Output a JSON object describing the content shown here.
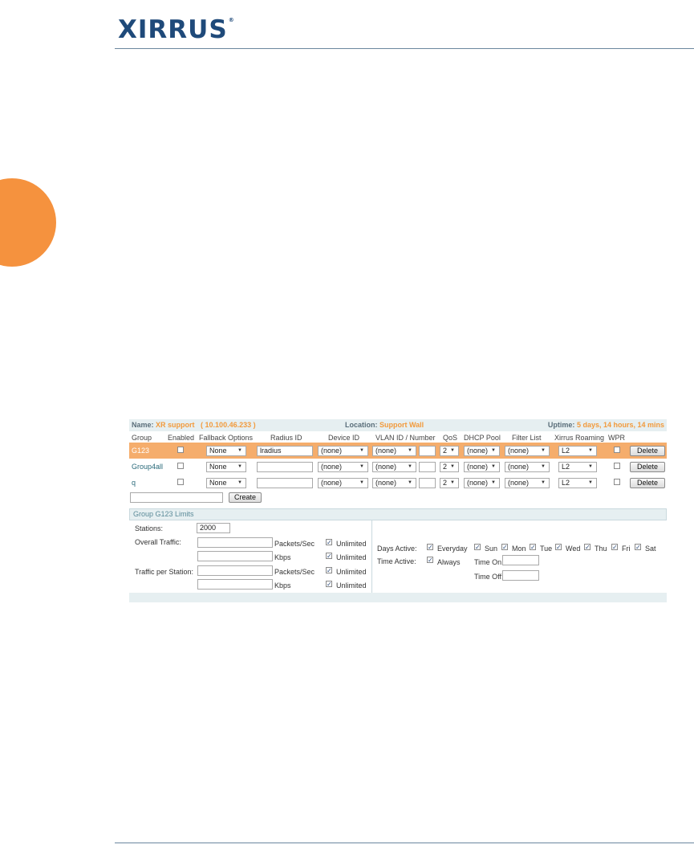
{
  "brand": {
    "logo_text": "XIRRUS",
    "logo_mark": "®"
  },
  "header": {
    "name_label": "Name:",
    "name_value": "XR support",
    "ip_value": "( 10.100.46.233 )",
    "location_label": "Location:",
    "location_value": "Support Wall",
    "uptime_label": "Uptime:",
    "uptime_value": "5 days, 14 hours, 14 mins"
  },
  "columns": [
    "Group",
    "Enabled",
    "Fallback Options",
    "Radius ID",
    "Device ID",
    "VLAN ID / Number",
    "QoS",
    "DHCP Pool",
    "Filter List",
    "Xirrus Roaming",
    "WPR"
  ],
  "groups": [
    {
      "name": "G123",
      "enabled": false,
      "fallback": "None",
      "radius_id": "lradius",
      "device_id": "(none)",
      "vlan": "(none)",
      "vlan_number": "",
      "qos": "2",
      "dhcp_pool": "(none)",
      "filter_list": "(none)",
      "roaming": "L2",
      "wpr": false,
      "delete_label": "Delete",
      "selected": true
    },
    {
      "name": "Group4all",
      "enabled": false,
      "fallback": "None",
      "radius_id": "",
      "device_id": "(none)",
      "vlan": "(none)",
      "vlan_number": "",
      "qos": "2",
      "dhcp_pool": "(none)",
      "filter_list": "(none)",
      "roaming": "L2",
      "wpr": false,
      "delete_label": "Delete",
      "selected": false
    },
    {
      "name": "q",
      "enabled": false,
      "fallback": "None",
      "radius_id": "",
      "device_id": "(none)",
      "vlan": "(none)",
      "vlan_number": "",
      "qos": "2",
      "dhcp_pool": "(none)",
      "filter_list": "(none)",
      "roaming": "L2",
      "wpr": false,
      "delete_label": "Delete",
      "selected": false
    }
  ],
  "create": {
    "input_value": "",
    "button_label": "Create"
  },
  "limits": {
    "title": "Group G123  Limits",
    "stations_label": "Stations:",
    "stations_value": "2000",
    "overall_label": "Overall Traffic:",
    "per_station_label": "Traffic per Station:",
    "pps_unit": "Packets/Sec",
    "kbps_unit": "Kbps",
    "unlimited_label": "Unlimited",
    "overall_pps": "",
    "overall_kbps": "",
    "station_pps": "",
    "station_kbps": "",
    "days_active_label": "Days Active:",
    "everyday_label": "Everyday",
    "days": [
      "Sun",
      "Mon",
      "Tue",
      "Wed",
      "Thu",
      "Fri",
      "Sat"
    ],
    "time_active_label": "Time Active:",
    "always_label": "Always",
    "time_on_label": "Time On:",
    "time_off_label": "Time Off:",
    "time_on_value": "",
    "time_off_value": ""
  },
  "colors": {
    "accent_orange": "#f5923e",
    "selected_row": "#f5ad6c",
    "header_bg": "#e6eff1",
    "logo_blue": "#1f4a7a"
  }
}
